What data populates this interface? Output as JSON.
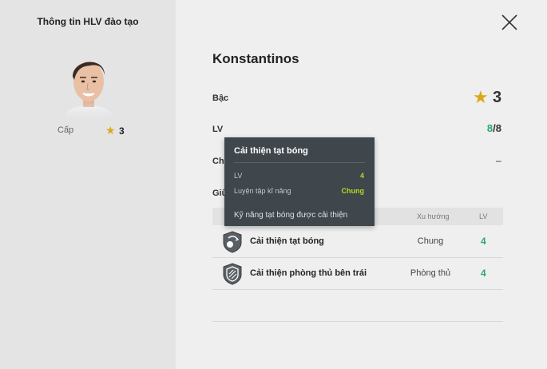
{
  "left_panel": {
    "title": "Thông tin HLV đào tạo",
    "level_label": "Cấp",
    "level_value": "3"
  },
  "coach": {
    "name": "Konstantinos",
    "rank_label": "Bậc",
    "rank_value": "3",
    "lv_label": "LV",
    "lv_current": "8",
    "lv_max": "/8",
    "chi_label": "Chỉ",
    "chi_value": "–",
    "giu_label": "Giữ"
  },
  "table": {
    "headers": {
      "category": "Xu hướng",
      "lv": "LV"
    },
    "rows": [
      {
        "name": "Cải thiện tạt bóng",
        "category": "Chung",
        "lv": "4",
        "icon": "crossing-ball-icon"
      },
      {
        "name": "Cải thiện phòng thủ bên trái",
        "category": "Phòng thủ",
        "lv": "4",
        "icon": "shield-icon"
      }
    ]
  },
  "tooltip": {
    "title": "Cải thiện tạt bóng",
    "lv_label": "LV",
    "lv_value": "4",
    "skill_label": "Luyện tập kĩ năng",
    "skill_value": "Chung",
    "description": "Kỹ năng tạt bóng được cải thiện"
  },
  "colors": {
    "accent_green": "#2aa86a",
    "tooltip_green": "#b4d820",
    "star_gold": "#d9a91a",
    "tooltip_bg": "#3f464c"
  }
}
